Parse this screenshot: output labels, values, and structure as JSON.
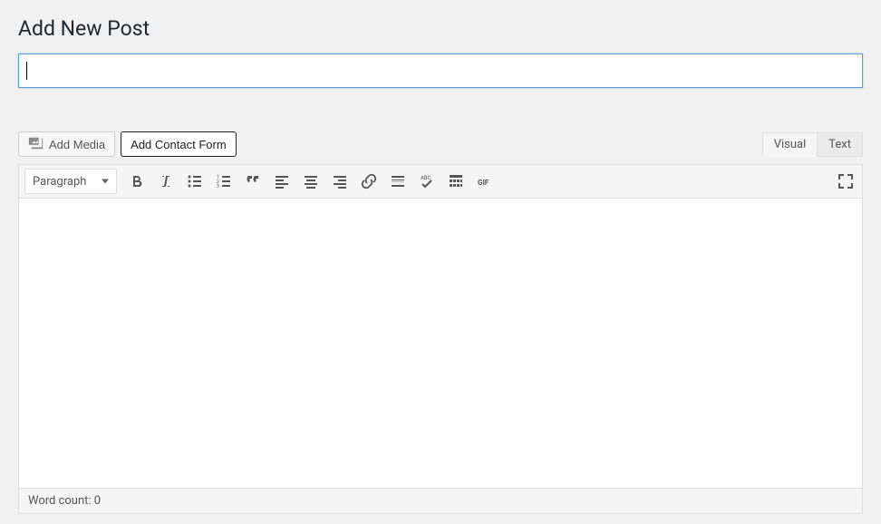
{
  "page": {
    "title": "Add New Post"
  },
  "titleField": {
    "value": "",
    "placeholder": ""
  },
  "buttons": {
    "addMedia": "Add Media",
    "addContactForm": "Add Contact Form"
  },
  "tabs": {
    "visual": "Visual",
    "text": "Text",
    "active": "visual"
  },
  "toolbar": {
    "formatSelect": "Paragraph"
  },
  "statusBar": {
    "wordCountLabel": "Word count:",
    "wordCountValue": "0"
  }
}
